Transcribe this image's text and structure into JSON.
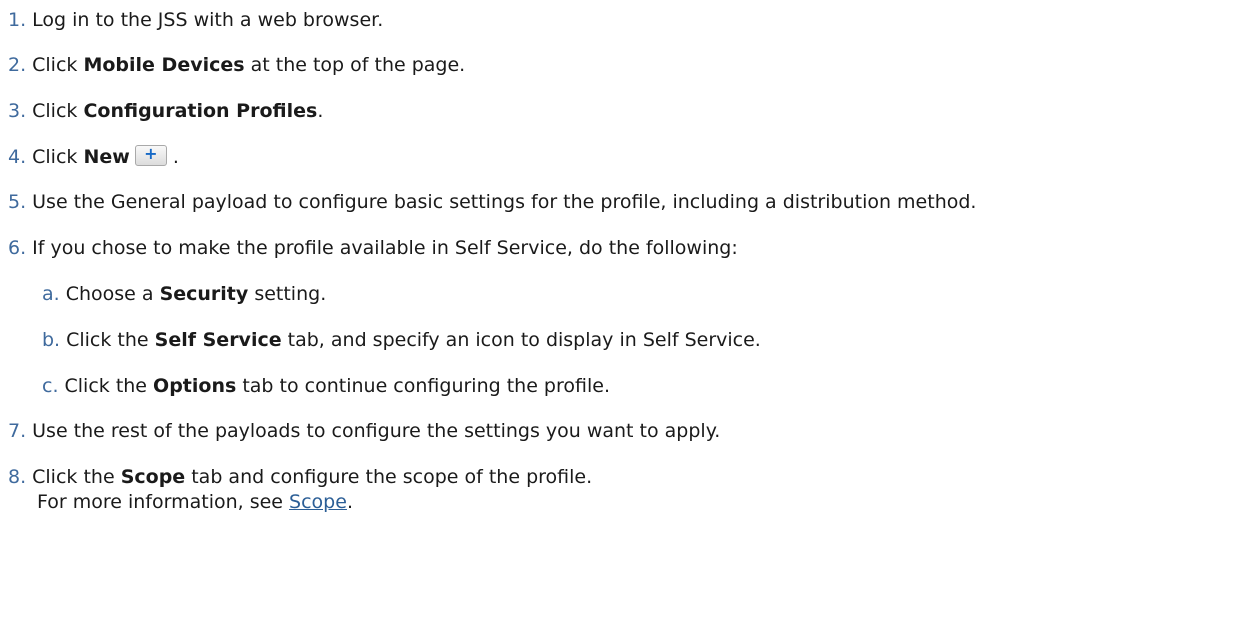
{
  "steps": [
    {
      "num": "1.",
      "text": "Log in to the JSS with a web browser."
    },
    {
      "num": "2.",
      "pre": "Click ",
      "bold": "Mobile Devices",
      "post": " at the top of the page."
    },
    {
      "num": "3.",
      "pre": "Click ",
      "bold": "Configuration Profiles",
      "post": "."
    },
    {
      "num": "4.",
      "pre": "Click ",
      "bold": "New",
      "post": " ."
    },
    {
      "num": "5.",
      "text": "Use the General payload to configure basic settings for the profile, including a distribution method."
    },
    {
      "num": "6.",
      "text": "If you chose to make the profile available in Self Service, do the following:"
    },
    {
      "num": "7.",
      "text": "Use the rest of the payloads to configure the settings you want to apply."
    },
    {
      "num": "8.",
      "pre": "Click the ",
      "bold": "Scope",
      "post": " tab and configure the scope of the profile."
    }
  ],
  "substeps": [
    {
      "num": "a.",
      "pre": "Choose a ",
      "bold": "Security",
      "post": " setting."
    },
    {
      "num": "b.",
      "pre": "Click the ",
      "bold": "Self Service",
      "post": " tab, and specify an icon to display in Self Service."
    },
    {
      "num": "c.",
      "pre": "Click the ",
      "bold": "Options",
      "post": " tab to continue configuring the profile."
    }
  ],
  "more_info": {
    "pre": "For more information, see ",
    "link": "Scope",
    "post": "."
  },
  "icons": {
    "new_button": "plus-icon"
  },
  "colors": {
    "number": "#3f6a9d",
    "link": "#2b5e96",
    "plus": "#1669c6"
  }
}
